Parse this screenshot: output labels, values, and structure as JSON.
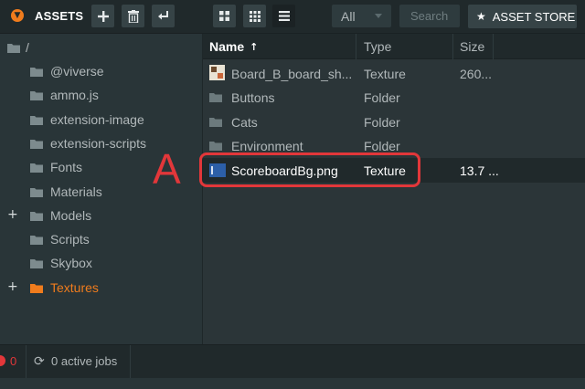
{
  "toolbar": {
    "title": "ASSETS",
    "filter_value": "All",
    "search_placeholder": "Search",
    "store_label": "ASSET STORE",
    "icons": [
      "chevron-down-icon",
      "add-icon",
      "delete-icon",
      "back-icon",
      "grid-large-icon",
      "grid-small-icon",
      "list-icon",
      "star-icon"
    ]
  },
  "tree": {
    "root_label": "/",
    "items": [
      {
        "label": "@viverse",
        "expandable": false,
        "selected": false
      },
      {
        "label": "ammo.js",
        "expandable": false,
        "selected": false
      },
      {
        "label": "extension-image",
        "expandable": false,
        "selected": false
      },
      {
        "label": "extension-scripts",
        "expandable": false,
        "selected": false
      },
      {
        "label": "Fonts",
        "expandable": false,
        "selected": false
      },
      {
        "label": "Materials",
        "expandable": false,
        "selected": false
      },
      {
        "label": "Models",
        "expandable": true,
        "selected": false
      },
      {
        "label": "Scripts",
        "expandable": false,
        "selected": false
      },
      {
        "label": "Skybox",
        "expandable": false,
        "selected": false
      },
      {
        "label": "Textures",
        "expandable": true,
        "selected": true
      }
    ],
    "expand_glyph": "+"
  },
  "table": {
    "columns": {
      "name": "Name",
      "type": "Type",
      "size": "Size"
    },
    "sort_glyph": "↑",
    "rows": [
      {
        "name": "Board_B_board_sh...",
        "type": "Texture",
        "size": "260...",
        "kind": "texture-thumb"
      },
      {
        "name": "Buttons",
        "type": "Folder",
        "size": "",
        "kind": "folder"
      },
      {
        "name": "Cats",
        "type": "Folder",
        "size": "",
        "kind": "folder"
      },
      {
        "name": "Environment",
        "type": "Folder",
        "size": "",
        "kind": "folder"
      },
      {
        "name": "ScoreboardBg.png",
        "type": "Texture",
        "size": "13.7 ...",
        "kind": "texture-blue"
      }
    ]
  },
  "annotation": {
    "letter": "A",
    "color": "#e2373a"
  },
  "status": {
    "error_count": "0",
    "jobs_label": "0 active jobs",
    "jobs_icon": "refresh-icon"
  },
  "colors": {
    "accent": "#f07c1d",
    "panel": "#20292b",
    "background": "#293538",
    "annotation": "#e2373a"
  }
}
